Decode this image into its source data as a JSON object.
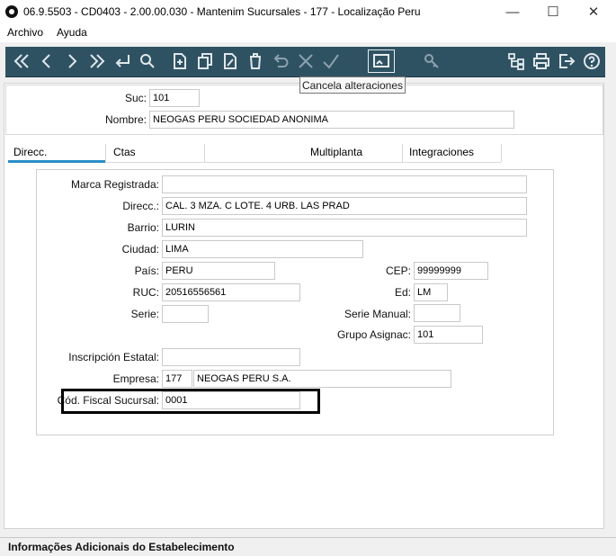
{
  "window": {
    "title": "06.9.5503 - CD0403 - 2.00.00.030 - Mantenim Sucursales - 177 - Localização Peru"
  },
  "menu": [
    "Archivo",
    "Ayuda"
  ],
  "toolbar": {
    "tooltip": "Cancela alteraciones",
    "icons": [
      "first-record-icon",
      "prev-record-icon",
      "next-record-icon",
      "last-record-icon",
      "enter-icon",
      "search-icon",
      "new-document-icon",
      "copy-icon",
      "edit-document-icon",
      "delete-icon",
      "undo-icon",
      "cancel-icon",
      "confirm-icon",
      "cancel-changes-icon",
      "key-icon",
      "hierarchy-icon",
      "print-icon",
      "exit-icon",
      "help-icon"
    ]
  },
  "header": {
    "suc_label": "Suc:",
    "suc_value": "101",
    "nombre_label": "Nombre:",
    "nombre_value": "NEOGAS PERU SOCIEDAD ANONIMA"
  },
  "tabs": [
    "Direcc.",
    "Ctas",
    "Multiplanta",
    "Integraciones"
  ],
  "form": {
    "marca_label": "Marca Registrada:",
    "marca_value": "",
    "direcc_label": "Direcc.:",
    "direcc_value": "CAL. 3 MZA. C LOTE. 4 URB. LAS PRAD",
    "barrio_label": "Barrio:",
    "barrio_value": "LURIN",
    "ciudad_label": "Ciudad:",
    "ciudad_value": "LIMA",
    "pais_label": "País:",
    "pais_value": "PERU",
    "cep_label": "CEP:",
    "cep_value": "99999999",
    "ruc_label": "RUC:",
    "ruc_value": "20516556561",
    "ed_label": "Ed:",
    "ed_value": "LM",
    "serie_label": "Serie:",
    "serie_value": "",
    "serie_manual_label": "Serie Manual:",
    "serie_manual_value": "",
    "grupo_label": "Grupo Asignac:",
    "grupo_value": "101",
    "inscripcion_label": "Inscripción Estatal:",
    "inscripcion_value": "",
    "empresa_label": "Empresa:",
    "empresa_code": "177",
    "empresa_name": "NEOGAS PERU S.A.",
    "cod_fiscal_label": "Cód. Fiscal Sucursal:",
    "cod_fiscal_value": "0001"
  },
  "status": "Informações Adicionais do Estabelecimento"
}
